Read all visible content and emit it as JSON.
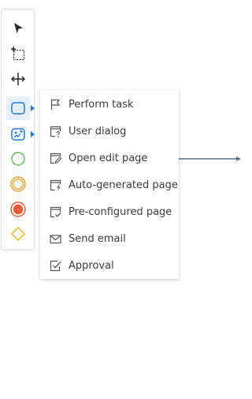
{
  "palette": {
    "tools": [
      {
        "icon": "pointer-icon",
        "title": ""
      },
      {
        "icon": "lasso-select-icon",
        "title": ""
      },
      {
        "icon": "space-tool-icon",
        "title": ""
      },
      {
        "icon": "task-icon",
        "title": ""
      },
      {
        "icon": "subprocess-icon",
        "title": ""
      },
      {
        "icon": "start-event-icon",
        "title": ""
      },
      {
        "icon": "intermediate-event-icon",
        "title": ""
      },
      {
        "icon": "end-event-icon",
        "title": ""
      },
      {
        "icon": "gateway-icon",
        "title": ""
      }
    ],
    "colors": {
      "blue": "#1e7bd6",
      "green": "#5cb85c",
      "orange": "#f0a030",
      "red": "#ee5a36",
      "gateway": "#f5b92a",
      "dark": "#2b2b2b"
    }
  },
  "menu": {
    "items": [
      {
        "icon": "flag-icon",
        "label": "Perform task"
      },
      {
        "icon": "user-dialog-icon",
        "label": "User dialog"
      },
      {
        "icon": "edit-page-icon",
        "label": "Open edit page"
      },
      {
        "icon": "auto-generated-page-icon",
        "label": "Auto-generated page"
      },
      {
        "icon": "preconfigured-page-icon",
        "label": "Pre-configured page"
      },
      {
        "icon": "envelope-icon",
        "label": "Send email"
      },
      {
        "icon": "approval-icon",
        "label": "Approval"
      }
    ],
    "text_color": "#3b3b3b",
    "icon_color": "#555555"
  },
  "canvas": {
    "connector_color": "#5c6e8a"
  }
}
